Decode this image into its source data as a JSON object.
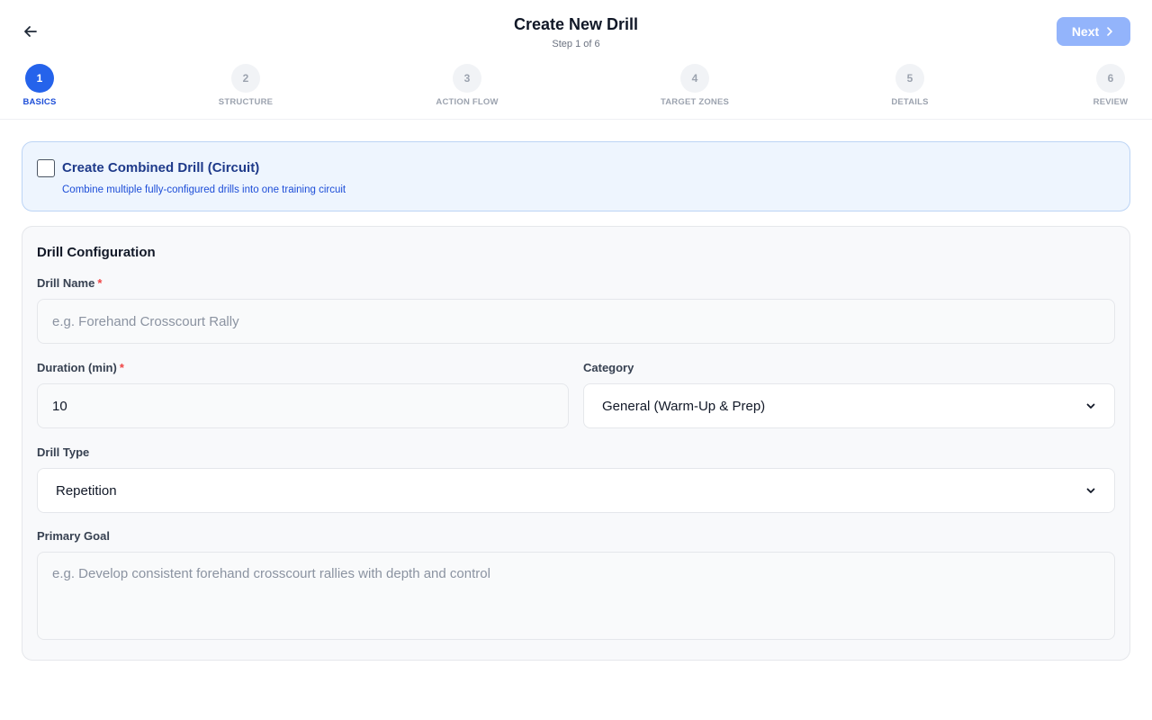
{
  "header": {
    "title": "Create New Drill",
    "step_text": "Step 1 of 6",
    "next_label": "Next"
  },
  "steps": [
    {
      "number": "1",
      "label": "BASICS",
      "active": true
    },
    {
      "number": "2",
      "label": "STRUCTURE",
      "active": false
    },
    {
      "number": "3",
      "label": "ACTION FLOW",
      "active": false
    },
    {
      "number": "4",
      "label": "TARGET ZONES",
      "active": false
    },
    {
      "number": "5",
      "label": "DETAILS",
      "active": false
    },
    {
      "number": "6",
      "label": "REVIEW",
      "active": false
    }
  ],
  "combined": {
    "title": "Create Combined Drill (Circuit)",
    "subtitle": "Combine multiple fully-configured drills into one training circuit",
    "checked": false
  },
  "config": {
    "title": "Drill Configuration",
    "drill_name_label": "Drill Name",
    "drill_name_placeholder": "e.g. Forehand Crosscourt Rally",
    "drill_name_value": "",
    "duration_label": "Duration (min)",
    "duration_value": "10",
    "category_label": "Category",
    "category_value": "General (Warm-Up & Prep)",
    "drill_type_label": "Drill Type",
    "drill_type_value": "Repetition",
    "primary_goal_label": "Primary Goal",
    "primary_goal_placeholder": "e.g. Develop consistent forehand crosscourt rallies with depth and control",
    "required_mark": "*"
  },
  "icons": {
    "back": "arrow-left-icon",
    "next": "chevron-right-icon",
    "select": "chevron-down-icon"
  },
  "colors": {
    "accent": "#2563eb",
    "next_button": "#93b4fb",
    "required": "#ef4444",
    "banner_bg": "#eef5fe"
  }
}
